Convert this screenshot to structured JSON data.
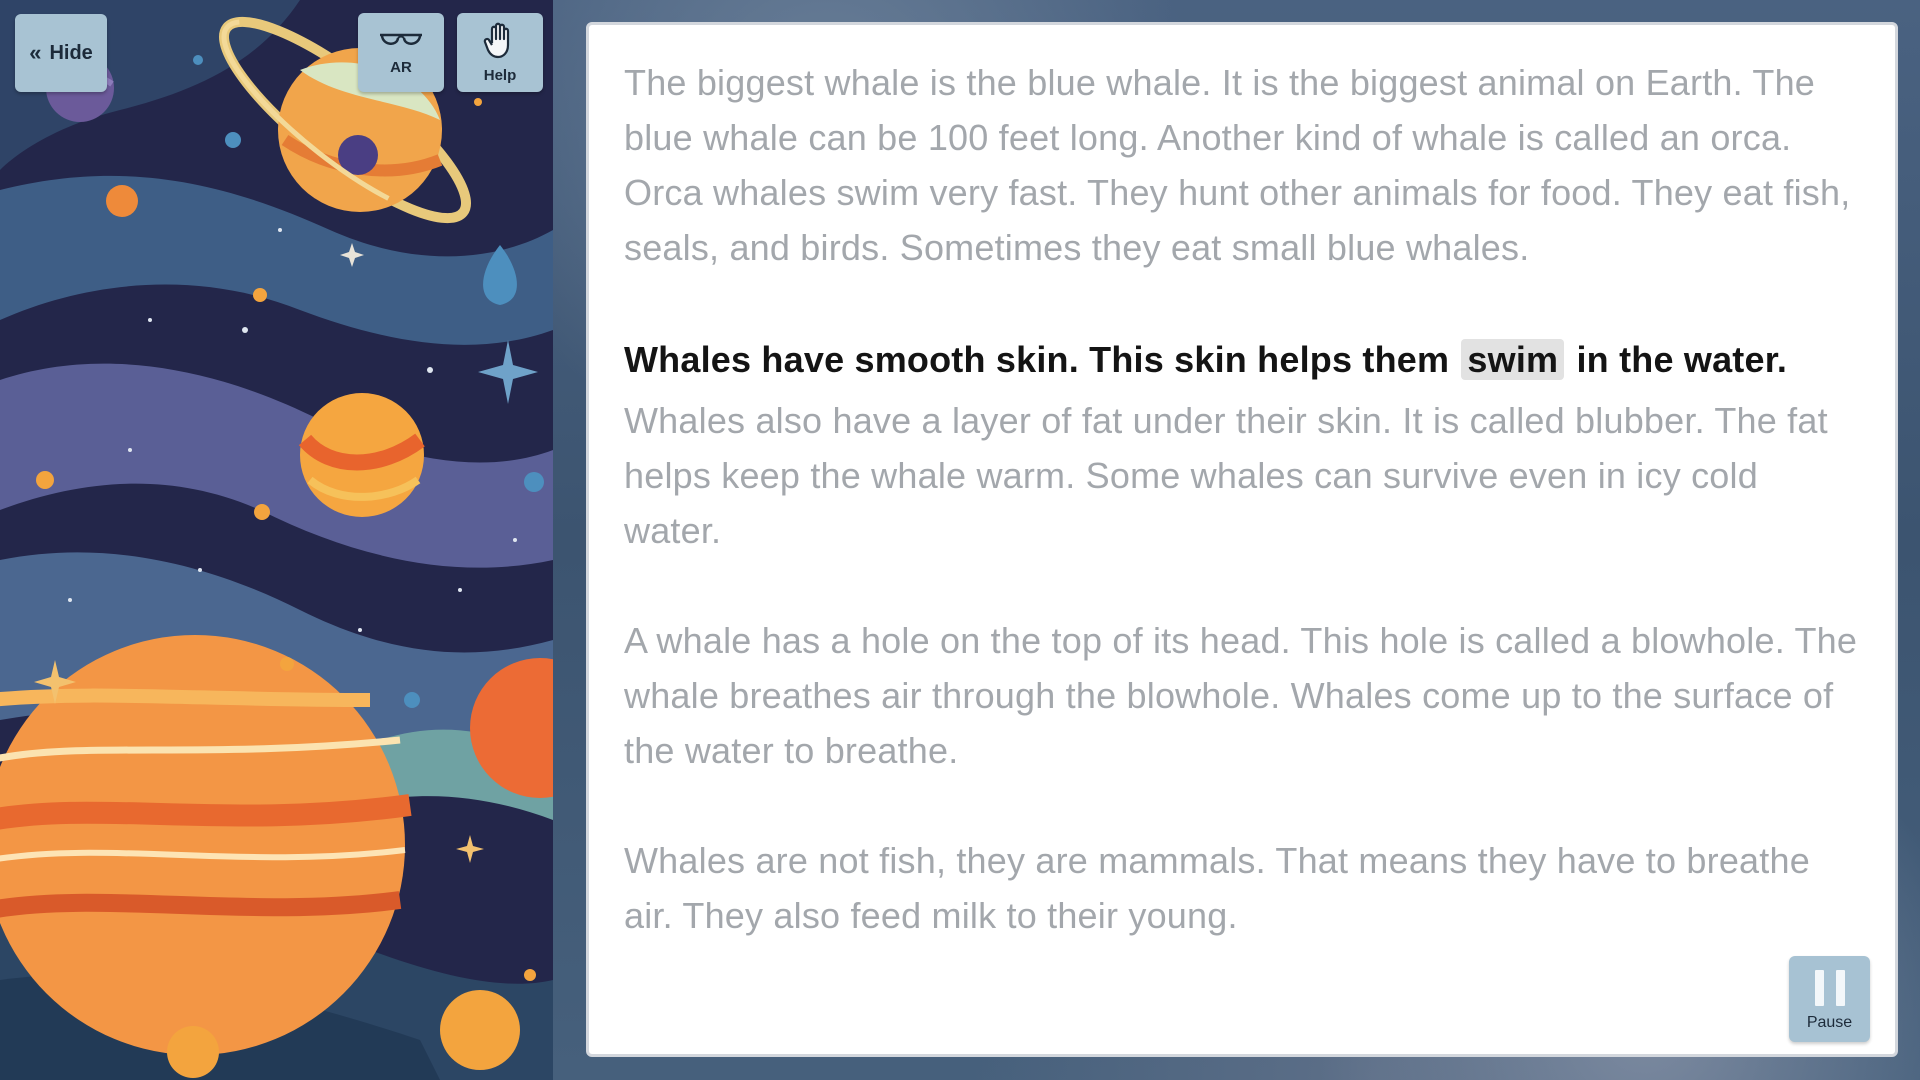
{
  "toolbar": {
    "hide_label": "Hide",
    "hide_chevron": "«",
    "ar_label": "AR",
    "help_label": "Help"
  },
  "reader": {
    "paragraphs": [
      {
        "text": "The biggest whale is the blue whale. It is the biggest animal on Earth. The blue whale can be 100 feet long. Another kind of whale is called an orca. Orca whales swim very fast. They hunt other animals for food. They eat fish, seals, and birds. Sometimes they eat small blue whales."
      },
      {
        "active_before": "Whales have smooth skin. This skin helps them",
        "active_word": "swim",
        "active_after": "in the water.",
        "rest": "Whales also have a layer of fat under their skin. It is called blubber. The fat helps keep the whale warm. Some whales can survive even in icy cold water."
      },
      {
        "text": "A whale has a hole on the top of its head. This hole is called a blowhole. The whale breathes air through the blowhole. Whales come up to the surface of the water to breathe."
      },
      {
        "text": "Whales are not fish, they are mammals. That means they have to breathe air. They also feed milk to their young."
      }
    ]
  },
  "controls": {
    "pause_label": "Pause"
  },
  "colors": {
    "button_bg": "#a8c3d3",
    "active_text": "#141414",
    "inactive_text": "#a3a7ac",
    "highlight": "#e2e2e2"
  },
  "icons": {
    "hide": "double-chevron-left-icon",
    "ar": "ar-glasses-icon",
    "help": "raised-hand-icon",
    "pause": "pause-icon"
  }
}
